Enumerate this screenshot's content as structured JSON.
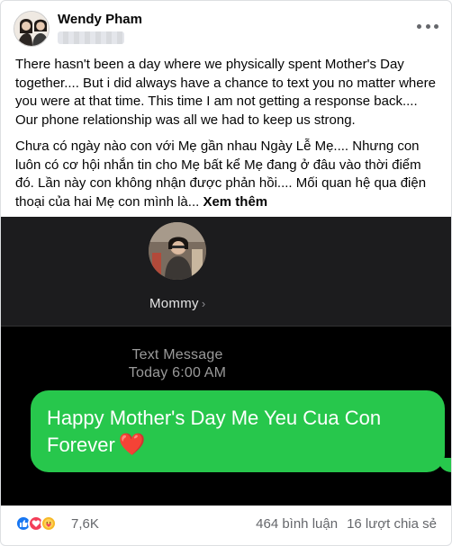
{
  "post": {
    "author": "Wendy Pham",
    "paragraphs": [
      "There hasn't been a day where we physically spent Mother's Day together.... But i did always have a chance to text you no matter where you were at that time. This time I am not getting a response back.... Our phone relationship was all we had to keep us strong.",
      "Chưa có ngày nào con với Mẹ gần nhau Ngày Lễ Mẹ....  Nhưng con luôn có cơ hội nhắn tin cho Mẹ bất kể Mẹ đang ở đâu vào thời điểm đó.  Lần này con không nhận được phản hồi....  Mối quan hệ qua điện thoại của hai Mẹ con mình là..."
    ],
    "see_more": "Xem thêm"
  },
  "photo": {
    "contact_name": "Mommy",
    "contact_chevron": "›",
    "message_type": "Text Message",
    "message_time": "Today 6:00 AM",
    "message_text": "Happy Mother's Day Me Yeu Cua Con Forever",
    "heart": "❤️"
  },
  "footer": {
    "reaction_count": "7,6K",
    "reaction_icons": [
      "like-icon",
      "love-icon",
      "care-icon"
    ],
    "comments": "464 bình luận",
    "shares": "16 lượt chia sẻ"
  }
}
